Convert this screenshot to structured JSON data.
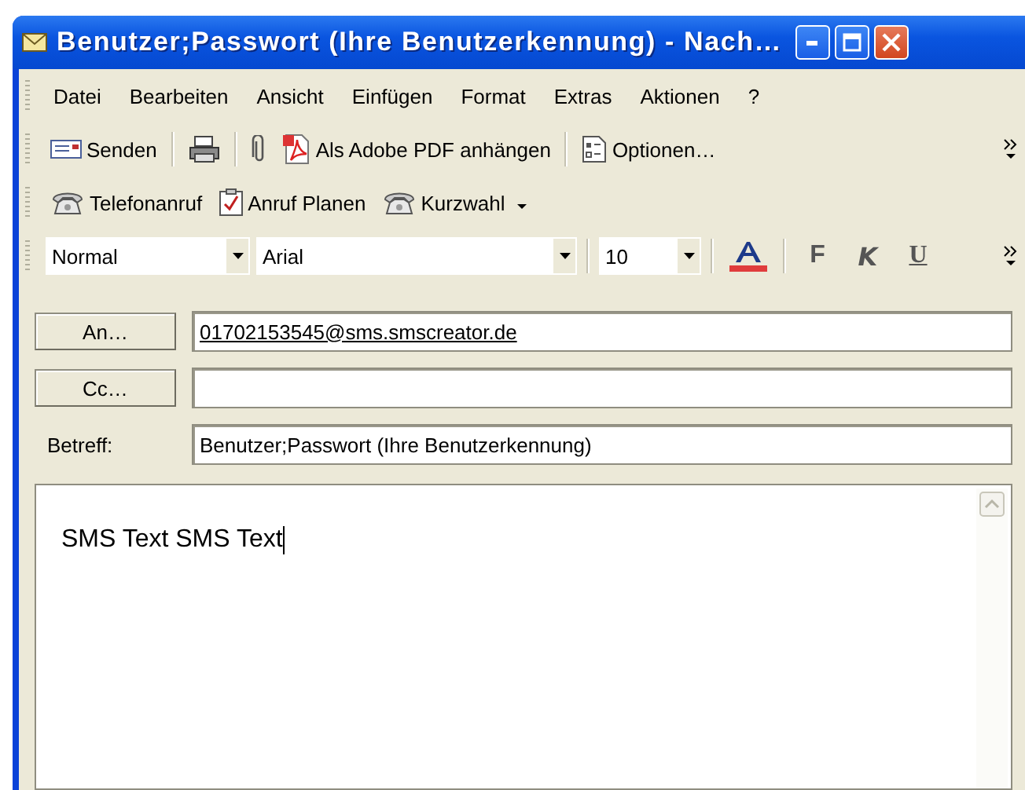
{
  "window": {
    "title": "Benutzer;Passwort (Ihre Benutzerkennung) - Nach…"
  },
  "menu": [
    "Datei",
    "Bearbeiten",
    "Ansicht",
    "Einfügen",
    "Format",
    "Extras",
    "Aktionen",
    "?"
  ],
  "toolbar_standard": [
    {
      "kind": "button",
      "label": "Senden"
    },
    {
      "kind": "separator"
    },
    {
      "kind": "icon"
    },
    {
      "kind": "separator"
    },
    {
      "kind": "icon"
    },
    {
      "kind": "button",
      "label": "Als Adobe PDF anhängen"
    },
    {
      "kind": "separator"
    },
    {
      "kind": "button",
      "label": "Optionen…"
    }
  ],
  "toolbar_phone": [
    {
      "kind": "button",
      "label": "Telefonanruf"
    },
    {
      "kind": "button",
      "label": "Anruf Planen"
    },
    {
      "kind": "button",
      "label": "Kurzwahl"
    }
  ],
  "toolbar_format": {
    "style": "Normal",
    "font": "Arial",
    "size": "10",
    "buttons": [
      "F",
      "K",
      "U"
    ]
  },
  "compose": {
    "to": {
      "button": "An…",
      "value": "01702153545@sms.smscreator.de"
    },
    "cc": {
      "button": "Cc…"
    },
    "subject": {
      "label": "Betreff:",
      "value": "Benutzer;Passwort (Ihre Benutzerkennung)"
    },
    "body": "SMS Text SMS Text"
  }
}
